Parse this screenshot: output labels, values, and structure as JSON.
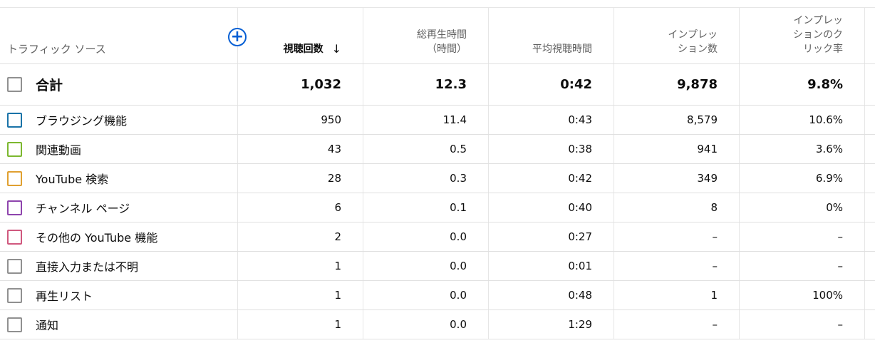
{
  "header": {
    "source": "トラフィック ソース",
    "views": "視聴回数",
    "sort_arrow": "↓",
    "watch_time_line1": "総再生時間",
    "watch_time_line2": "（時間）",
    "avg_duration": "平均視聴時間",
    "impressions_line1": "インプレッ",
    "impressions_line2": "ション数",
    "ctr_line1": "インプレッ",
    "ctr_line2": "ションのク",
    "ctr_line3": "リック率",
    "add_icon": "+"
  },
  "total": {
    "label": "合計",
    "views": "1,032",
    "watch_time": "12.3",
    "avg_duration": "0:42",
    "impressions": "9,878",
    "ctr": "9.8%"
  },
  "rows": [
    {
      "label": "ブラウジング機能",
      "color": "#1a73a8",
      "views": "950",
      "watch_time": "11.4",
      "avg_duration": "0:43",
      "impressions": "8,579",
      "ctr": "10.6%"
    },
    {
      "label": "関連動画",
      "color": "#7cb82f",
      "views": "43",
      "watch_time": "0.5",
      "avg_duration": "0:38",
      "impressions": "941",
      "ctr": "3.6%"
    },
    {
      "label": "YouTube 検索",
      "color": "#e0a030",
      "views": "28",
      "watch_time": "0.3",
      "avg_duration": "0:42",
      "impressions": "349",
      "ctr": "6.9%"
    },
    {
      "label": "チャンネル ページ",
      "color": "#8e44ad",
      "views": "6",
      "watch_time": "0.1",
      "avg_duration": "0:40",
      "impressions": "8",
      "ctr": "0%"
    },
    {
      "label": "その他の YouTube 機能",
      "color": "#d0587e",
      "views": "2",
      "watch_time": "0.0",
      "avg_duration": "0:27",
      "impressions": "–",
      "ctr": "–"
    },
    {
      "label": "直接入力または不明",
      "color": "#909090",
      "views": "1",
      "watch_time": "0.0",
      "avg_duration": "0:01",
      "impressions": "–",
      "ctr": "–"
    },
    {
      "label": "再生リスト",
      "color": "#909090",
      "views": "1",
      "watch_time": "0.0",
      "avg_duration": "0:48",
      "impressions": "1",
      "ctr": "100%"
    },
    {
      "label": "通知",
      "color": "#909090",
      "views": "1",
      "watch_time": "0.0",
      "avg_duration": "1:29",
      "impressions": "–",
      "ctr": "–"
    }
  ]
}
